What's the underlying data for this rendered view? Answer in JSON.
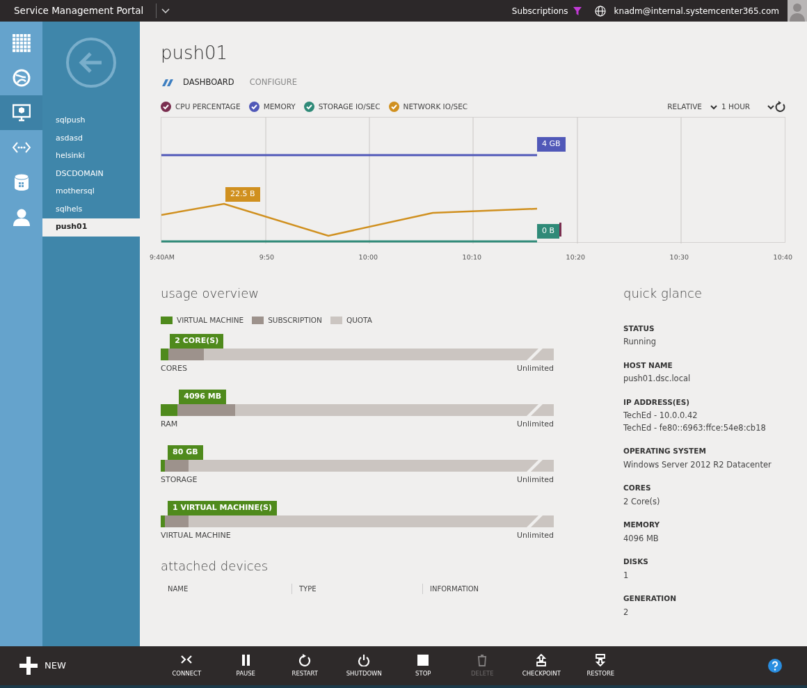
{
  "top_bar": {
    "title": "Service Management Portal",
    "subscriptions": "Subscriptions",
    "user": "knadm@internal.systemcenter365.com"
  },
  "nav_icons": [
    {
      "kind": "grid",
      "selected": false
    },
    {
      "kind": "globe",
      "selected": false
    },
    {
      "kind": "monitor",
      "selected": true
    },
    {
      "kind": "network",
      "selected": false
    },
    {
      "kind": "database",
      "selected": false
    },
    {
      "kind": "user",
      "selected": false
    }
  ],
  "sidebar": {
    "items": [
      {
        "label": "sqlpush",
        "selected": false
      },
      {
        "label": "asdasd",
        "selected": false
      },
      {
        "label": "helsinki",
        "selected": false
      },
      {
        "label": "DSCDOMAIN",
        "selected": false
      },
      {
        "label": "mothersql",
        "selected": false
      },
      {
        "label": "sqlhels",
        "selected": false
      },
      {
        "label": "push01",
        "selected": true
      }
    ]
  },
  "page_title": "push01",
  "tabs": [
    {
      "label": "DASHBOARD",
      "selected": true
    },
    {
      "label": "CONFIGURE",
      "selected": false
    }
  ],
  "chart": {
    "legend": [
      {
        "label": "CPU PERCENTAGE",
        "color": "#7a2e4f",
        "checked": true
      },
      {
        "label": "MEMORY",
        "color": "#5058b8",
        "checked": true
      },
      {
        "label": "STORAGE IO/SEC",
        "color": "#2f8a78",
        "checked": true
      },
      {
        "label": "NETWORK IO/SEC",
        "color": "#d0901f",
        "checked": true
      }
    ],
    "relative": "RELATIVE",
    "range": "1 HOUR",
    "callouts": [
      {
        "text": "4 GB",
        "color": "#5058b8"
      },
      {
        "text": "22.5 B",
        "color": "#d0901f"
      },
      {
        "text": "0 B",
        "color": "#2f8a78"
      }
    ],
    "x_labels": [
      "9:40AM",
      "9:50",
      "10:00",
      "10:10",
      "10:20",
      "10:30",
      "10:40"
    ]
  },
  "usage": {
    "title": "usage overview",
    "legend": [
      {
        "label": "VIRTUAL MACHINE",
        "color": "#4f8a1c"
      },
      {
        "label": "SUBSCRIPTION",
        "color": "#9d928c"
      },
      {
        "label": "QUOTA",
        "color": "#cbc5c1"
      }
    ],
    "rows": [
      {
        "label": "CORES",
        "tag": "2 CORE(S)",
        "level": 0.02,
        "subscription": {
          "level": 0.11
        },
        "limit": "Unlimited"
      },
      {
        "label": "RAM",
        "tag": "4096 MB",
        "level": 0.043,
        "subscription": {
          "level": 0.19
        },
        "limit": "Unlimited"
      },
      {
        "label": "STORAGE",
        "tag": "80 GB",
        "level": 0.01,
        "subscription": {
          "level": 0.07
        },
        "limit": "Unlimited"
      },
      {
        "label": "VIRTUAL MACHINE",
        "tag": "1 VIRTUAL MACHINE(S)",
        "level": 0.01,
        "subscription": {
          "level": 0.07
        },
        "limit": "Unlimited"
      }
    ]
  },
  "attached_devices": {
    "title": "attached devices",
    "columns": [
      "NAME",
      "TYPE",
      "INFORMATION"
    ]
  },
  "quick_glance": {
    "title": "quick glance",
    "fields": [
      {
        "label": "STATUS",
        "values": [
          "Running"
        ]
      },
      {
        "label": "HOST NAME",
        "values": [
          "push01.dsc.local"
        ]
      },
      {
        "label": "IP ADDRESS(ES)",
        "values": [
          "TechEd - 10.0.0.42",
          "TechEd - fe80::6963:ffce:54e8:cb18"
        ]
      },
      {
        "label": "OPERATING SYSTEM",
        "values": [
          "Windows Server 2012 R2 Datacenter"
        ]
      },
      {
        "label": "CORES",
        "values": [
          "2 Core(s)"
        ]
      },
      {
        "label": "MEMORY",
        "values": [
          "4096 MB"
        ]
      },
      {
        "label": "DISKS",
        "values": [
          "1"
        ]
      },
      {
        "label": "GENERATION",
        "values": [
          "2"
        ]
      }
    ]
  },
  "command_bar": {
    "new": "NEW",
    "actions": [
      {
        "kind": "connect",
        "label": "CONNECT",
        "disabled": false
      },
      {
        "kind": "pause",
        "label": "PAUSE",
        "disabled": false
      },
      {
        "kind": "restart",
        "label": "RESTART",
        "disabled": false
      },
      {
        "kind": "shutdown",
        "label": "SHUTDOWN",
        "disabled": false
      },
      {
        "kind": "stop",
        "label": "STOP",
        "disabled": false
      },
      {
        "kind": "delete",
        "label": "DELETE",
        "disabled": true
      },
      {
        "kind": "checkpoint",
        "label": "CHECKPOINT",
        "disabled": false
      },
      {
        "kind": "restore",
        "label": "RESTORE",
        "disabled": false
      }
    ]
  }
}
